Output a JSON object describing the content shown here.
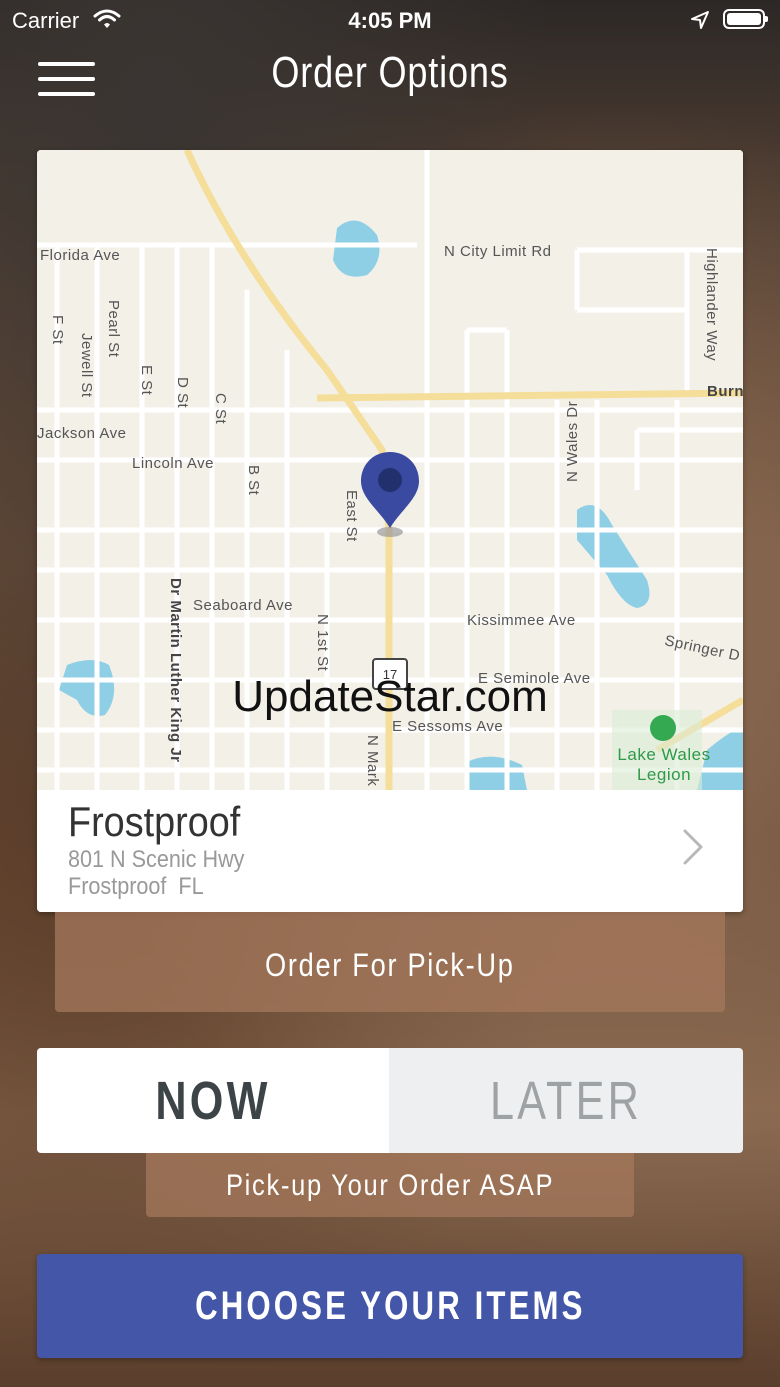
{
  "status_bar": {
    "carrier": "Carrier",
    "time": "4:05 PM"
  },
  "header": {
    "title": "Order Options"
  },
  "map": {
    "labels": {
      "florida_ave": "Florida Ave",
      "n_city_limit_rd": "N City Limit Rd",
      "highlander_way": "Highlander Way",
      "burn": "Burn",
      "f_st": "F St",
      "pearl_st": "Pearl St",
      "jewell_st": "Jewell St",
      "e_st": "E St",
      "d_st": "D St",
      "c_st": "C St",
      "jackson_ave": "Jackson Ave",
      "lincoln_ave": "Lincoln Ave",
      "b_st": "B St",
      "east_st": "East St",
      "n_wales_dr": "N Wales Dr",
      "dr_mlk_jr": "Dr Martin Luther King Jr",
      "seaboard_ave": "Seaboard Ave",
      "n_1st_st": "N 1st St",
      "kissimmee_ave": "Kissimmee Ave",
      "springer_dr": "Springer D",
      "e_seminole_ave": "E Seminole Ave",
      "e_sessoms_ave": "E Sessoms Ave",
      "n_mark": "N Mark",
      "lake_wales_legion": "Lake Wales Legion",
      "highway_number": "17"
    },
    "watermark": "UpdateStar.com"
  },
  "store": {
    "name": "Frostproof",
    "address": "801 N Scenic Hwy",
    "city_state": "Frostproof  FL"
  },
  "order_type": {
    "label": "Order For Pick-Up"
  },
  "timing": {
    "now_label": "NOW",
    "later_label": "LATER",
    "selected": "NOW",
    "hint": "Pick-up Your Order ASAP"
  },
  "cta": {
    "label": "CHOOSE YOUR ITEMS"
  },
  "colors": {
    "primary_button": "#4356a8",
    "map_pin": "#3a4aa0",
    "park": "#35a852",
    "water": "#8fcfe6"
  }
}
